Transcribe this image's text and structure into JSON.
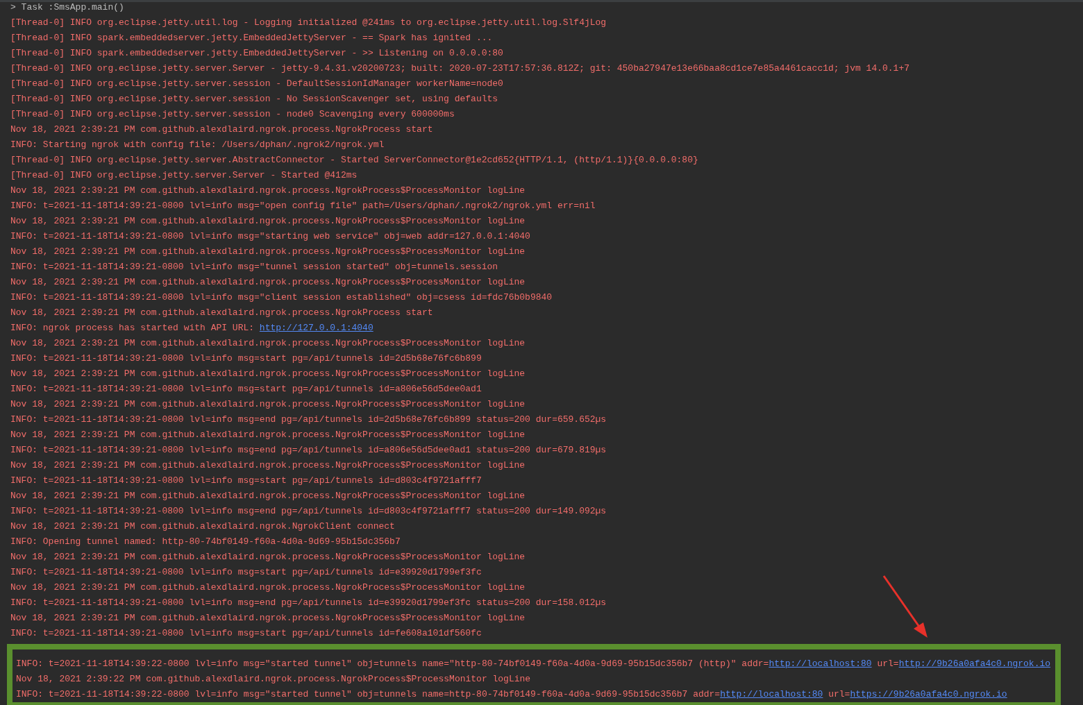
{
  "task_header": "> Task :SmsApp.main()",
  "lines": [
    {
      "segments": [
        {
          "kind": "text",
          "text": "[Thread-0] INFO org.eclipse.jetty.util.log - Logging initialized @241ms to org.eclipse.jetty.util.log.Slf4jLog"
        }
      ]
    },
    {
      "segments": [
        {
          "kind": "text",
          "text": "[Thread-0] INFO spark.embeddedserver.jetty.EmbeddedJettyServer - == Spark has ignited ..."
        }
      ]
    },
    {
      "segments": [
        {
          "kind": "text",
          "text": "[Thread-0] INFO spark.embeddedserver.jetty.EmbeddedJettyServer - >> Listening on 0.0.0.0:80"
        }
      ]
    },
    {
      "segments": [
        {
          "kind": "text",
          "text": "[Thread-0] INFO org.eclipse.jetty.server.Server - jetty-9.4.31.v20200723; built: 2020-07-23T17:57:36.812Z; git: 450ba27947e13e66baa8cd1ce7e85a4461cacc1d; jvm 14.0.1+7"
        }
      ]
    },
    {
      "segments": [
        {
          "kind": "text",
          "text": "[Thread-0] INFO org.eclipse.jetty.server.session - DefaultSessionIdManager workerName=node0"
        }
      ]
    },
    {
      "segments": [
        {
          "kind": "text",
          "text": "[Thread-0] INFO org.eclipse.jetty.server.session - No SessionScavenger set, using defaults"
        }
      ]
    },
    {
      "segments": [
        {
          "kind": "text",
          "text": "[Thread-0] INFO org.eclipse.jetty.server.session - node0 Scavenging every 600000ms"
        }
      ]
    },
    {
      "segments": [
        {
          "kind": "text",
          "text": "Nov 18, 2021 2:39:21 PM com.github.alexdlaird.ngrok.process.NgrokProcess start"
        }
      ]
    },
    {
      "segments": [
        {
          "kind": "text",
          "text": "INFO: Starting ngrok with config file: /Users/dphan/.ngrok2/ngrok.yml"
        }
      ]
    },
    {
      "segments": [
        {
          "kind": "text",
          "text": "[Thread-0] INFO org.eclipse.jetty.server.AbstractConnector - Started ServerConnector@1e2cd652{HTTP/1.1, (http/1.1)}{0.0.0.0:80}"
        }
      ]
    },
    {
      "segments": [
        {
          "kind": "text",
          "text": "[Thread-0] INFO org.eclipse.jetty.server.Server - Started @412ms"
        }
      ]
    },
    {
      "segments": [
        {
          "kind": "text",
          "text": "Nov 18, 2021 2:39:21 PM com.github.alexdlaird.ngrok.process.NgrokProcess$ProcessMonitor logLine"
        }
      ]
    },
    {
      "segments": [
        {
          "kind": "text",
          "text": "INFO: t=2021-11-18T14:39:21-0800 lvl=info msg=\"open config file\" path=/Users/dphan/.ngrok2/ngrok.yml err=nil"
        }
      ]
    },
    {
      "segments": [
        {
          "kind": "text",
          "text": "Nov 18, 2021 2:39:21 PM com.github.alexdlaird.ngrok.process.NgrokProcess$ProcessMonitor logLine"
        }
      ]
    },
    {
      "segments": [
        {
          "kind": "text",
          "text": "INFO: t=2021-11-18T14:39:21-0800 lvl=info msg=\"starting web service\" obj=web addr=127.0.0.1:4040"
        }
      ]
    },
    {
      "segments": [
        {
          "kind": "text",
          "text": "Nov 18, 2021 2:39:21 PM com.github.alexdlaird.ngrok.process.NgrokProcess$ProcessMonitor logLine"
        }
      ]
    },
    {
      "segments": [
        {
          "kind": "text",
          "text": "INFO: t=2021-11-18T14:39:21-0800 lvl=info msg=\"tunnel session started\" obj=tunnels.session"
        }
      ]
    },
    {
      "segments": [
        {
          "kind": "text",
          "text": "Nov 18, 2021 2:39:21 PM com.github.alexdlaird.ngrok.process.NgrokProcess$ProcessMonitor logLine"
        }
      ]
    },
    {
      "segments": [
        {
          "kind": "text",
          "text": "INFO: t=2021-11-18T14:39:21-0800 lvl=info msg=\"client session established\" obj=csess id=fdc76b0b9840"
        }
      ]
    },
    {
      "segments": [
        {
          "kind": "text",
          "text": "Nov 18, 2021 2:39:21 PM com.github.alexdlaird.ngrok.process.NgrokProcess start"
        }
      ]
    },
    {
      "segments": [
        {
          "kind": "text",
          "text": "INFO: ngrok process has started with API URL: "
        },
        {
          "kind": "link",
          "text": "http://127.0.0.1:4040"
        }
      ]
    },
    {
      "segments": [
        {
          "kind": "text",
          "text": "Nov 18, 2021 2:39:21 PM com.github.alexdlaird.ngrok.process.NgrokProcess$ProcessMonitor logLine"
        }
      ]
    },
    {
      "segments": [
        {
          "kind": "text",
          "text": "INFO: t=2021-11-18T14:39:21-0800 lvl=info msg=start pg=/api/tunnels id=2d5b68e76fc6b899"
        }
      ]
    },
    {
      "segments": [
        {
          "kind": "text",
          "text": "Nov 18, 2021 2:39:21 PM com.github.alexdlaird.ngrok.process.NgrokProcess$ProcessMonitor logLine"
        }
      ]
    },
    {
      "segments": [
        {
          "kind": "text",
          "text": "INFO: t=2021-11-18T14:39:21-0800 lvl=info msg=start pg=/api/tunnels id=a806e56d5dee0ad1"
        }
      ]
    },
    {
      "segments": [
        {
          "kind": "text",
          "text": "Nov 18, 2021 2:39:21 PM com.github.alexdlaird.ngrok.process.NgrokProcess$ProcessMonitor logLine"
        }
      ]
    },
    {
      "segments": [
        {
          "kind": "text",
          "text": "INFO: t=2021-11-18T14:39:21-0800 lvl=info msg=end pg=/api/tunnels id=2d5b68e76fc6b899 status=200 dur=659.652µs"
        }
      ]
    },
    {
      "segments": [
        {
          "kind": "text",
          "text": "Nov 18, 2021 2:39:21 PM com.github.alexdlaird.ngrok.process.NgrokProcess$ProcessMonitor logLine"
        }
      ]
    },
    {
      "segments": [
        {
          "kind": "text",
          "text": "INFO: t=2021-11-18T14:39:21-0800 lvl=info msg=end pg=/api/tunnels id=a806e56d5dee0ad1 status=200 dur=679.819µs"
        }
      ]
    },
    {
      "segments": [
        {
          "kind": "text",
          "text": "Nov 18, 2021 2:39:21 PM com.github.alexdlaird.ngrok.process.NgrokProcess$ProcessMonitor logLine"
        }
      ]
    },
    {
      "segments": [
        {
          "kind": "text",
          "text": "INFO: t=2021-11-18T14:39:21-0800 lvl=info msg=start pg=/api/tunnels id=d803c4f9721afff7"
        }
      ]
    },
    {
      "segments": [
        {
          "kind": "text",
          "text": "Nov 18, 2021 2:39:21 PM com.github.alexdlaird.ngrok.process.NgrokProcess$ProcessMonitor logLine"
        }
      ]
    },
    {
      "segments": [
        {
          "kind": "text",
          "text": "INFO: t=2021-11-18T14:39:21-0800 lvl=info msg=end pg=/api/tunnels id=d803c4f9721afff7 status=200 dur=149.092µs"
        }
      ]
    },
    {
      "segments": [
        {
          "kind": "text",
          "text": "Nov 18, 2021 2:39:21 PM com.github.alexdlaird.ngrok.NgrokClient connect"
        }
      ]
    },
    {
      "segments": [
        {
          "kind": "text",
          "text": "INFO: Opening tunnel named: http-80-74bf0149-f60a-4d0a-9d69-95b15dc356b7"
        }
      ]
    },
    {
      "segments": [
        {
          "kind": "text",
          "text": "Nov 18, 2021 2:39:21 PM com.github.alexdlaird.ngrok.process.NgrokProcess$ProcessMonitor logLine"
        }
      ]
    },
    {
      "segments": [
        {
          "kind": "text",
          "text": "INFO: t=2021-11-18T14:39:21-0800 lvl=info msg=start pg=/api/tunnels id=e39920d1799ef3fc"
        }
      ]
    },
    {
      "segments": [
        {
          "kind": "text",
          "text": "Nov 18, 2021 2:39:21 PM com.github.alexdlaird.ngrok.process.NgrokProcess$ProcessMonitor logLine"
        }
      ]
    },
    {
      "segments": [
        {
          "kind": "text",
          "text": "INFO: t=2021-11-18T14:39:21-0800 lvl=info msg=end pg=/api/tunnels id=e39920d1799ef3fc status=200 dur=158.012µs"
        }
      ]
    },
    {
      "segments": [
        {
          "kind": "text",
          "text": "Nov 18, 2021 2:39:21 PM com.github.alexdlaird.ngrok.process.NgrokProcess$ProcessMonitor logLine"
        }
      ]
    },
    {
      "segments": [
        {
          "kind": "text",
          "text": "INFO: t=2021-11-18T14:39:21-0800 lvl=info msg=start pg=/api/tunnels id=fe608a101df560fc"
        }
      ]
    }
  ],
  "highlighted_lines": [
    {
      "segments": [
        {
          "kind": "text",
          "text": "INFO: t=2021-11-18T14:39:22-0800 lvl=info msg=\"started tunnel\" obj=tunnels name=\"http-80-74bf0149-f60a-4d0a-9d69-95b15dc356b7 (http)\" addr="
        },
        {
          "kind": "link",
          "text": "http://localhost:80"
        },
        {
          "kind": "text",
          "text": " url="
        },
        {
          "kind": "link",
          "text": "http://9b26a0afa4c0.ngrok.io"
        }
      ]
    },
    {
      "segments": [
        {
          "kind": "text",
          "text": "Nov 18, 2021 2:39:22 PM com.github.alexdlaird.ngrok.process.NgrokProcess$ProcessMonitor logLine"
        }
      ]
    },
    {
      "segments": [
        {
          "kind": "text",
          "text": "INFO: t=2021-11-18T14:39:22-0800 lvl=info msg=\"started tunnel\" obj=tunnels name=http-80-74bf0149-f60a-4d0a-9d69-95b15dc356b7 addr="
        },
        {
          "kind": "link",
          "text": "http://localhost:80"
        },
        {
          "kind": "text",
          "text": " url="
        },
        {
          "kind": "link",
          "text": "https://9b26a0afa4c0.ngrok.io"
        }
      ]
    }
  ]
}
